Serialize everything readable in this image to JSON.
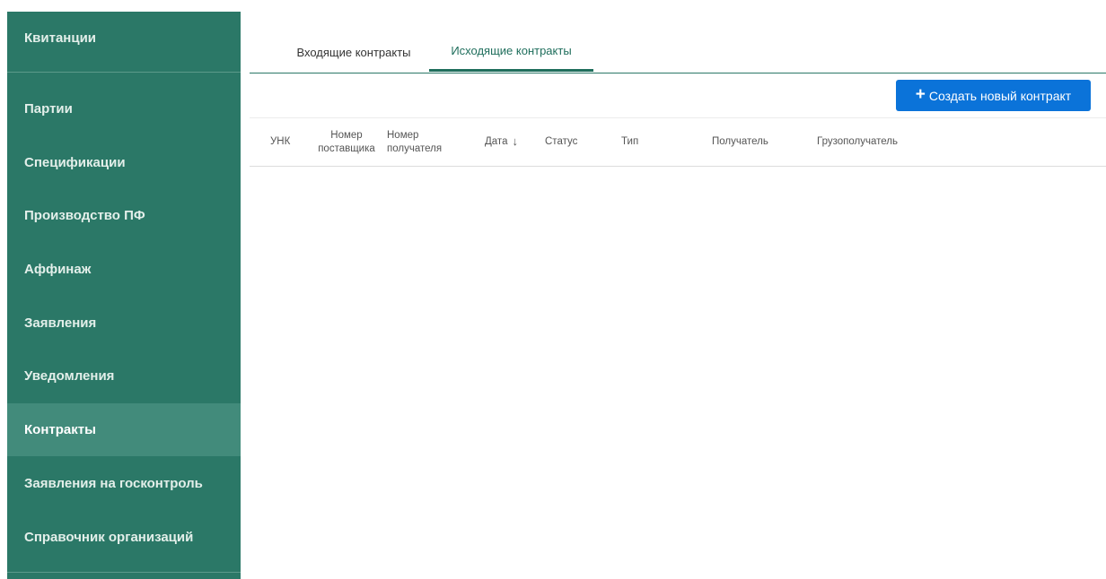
{
  "sidebar": {
    "items": [
      {
        "label": "Квитанции"
      },
      {
        "label": "Партии"
      },
      {
        "label": "Спецификации"
      },
      {
        "label": "Производство ПФ"
      },
      {
        "label": "Аффинаж"
      },
      {
        "label": "Заявления"
      },
      {
        "label": "Уведомления"
      },
      {
        "label": "Контракты",
        "active": true
      },
      {
        "label": "Заявления на госконтроль"
      },
      {
        "label": "Справочник организаций"
      }
    ]
  },
  "tabs": [
    {
      "label": "Входящие контракты",
      "active": false
    },
    {
      "label": "Исходящие контракты",
      "active": true
    }
  ],
  "toolbar": {
    "create_icon": "plus-icon",
    "create_label": "Создать новый контракт"
  },
  "table": {
    "columns": {
      "unk": "УНК",
      "supplier_no_1": "Номер",
      "supplier_no_2": "поставщика",
      "recipient_no_1": "Номер",
      "recipient_no_2": "получателя",
      "date": "Дата",
      "date_sort": "descending",
      "status": "Статус",
      "type": "Тип",
      "recipient": "Получатель",
      "consignee": "Грузополучатель"
    },
    "rows": []
  },
  "colors": {
    "sidebar_bg": "#2b7867",
    "sidebar_active": "#428b7b",
    "accent_tab": "#1f6e5c",
    "primary_button": "#0b73d9"
  }
}
